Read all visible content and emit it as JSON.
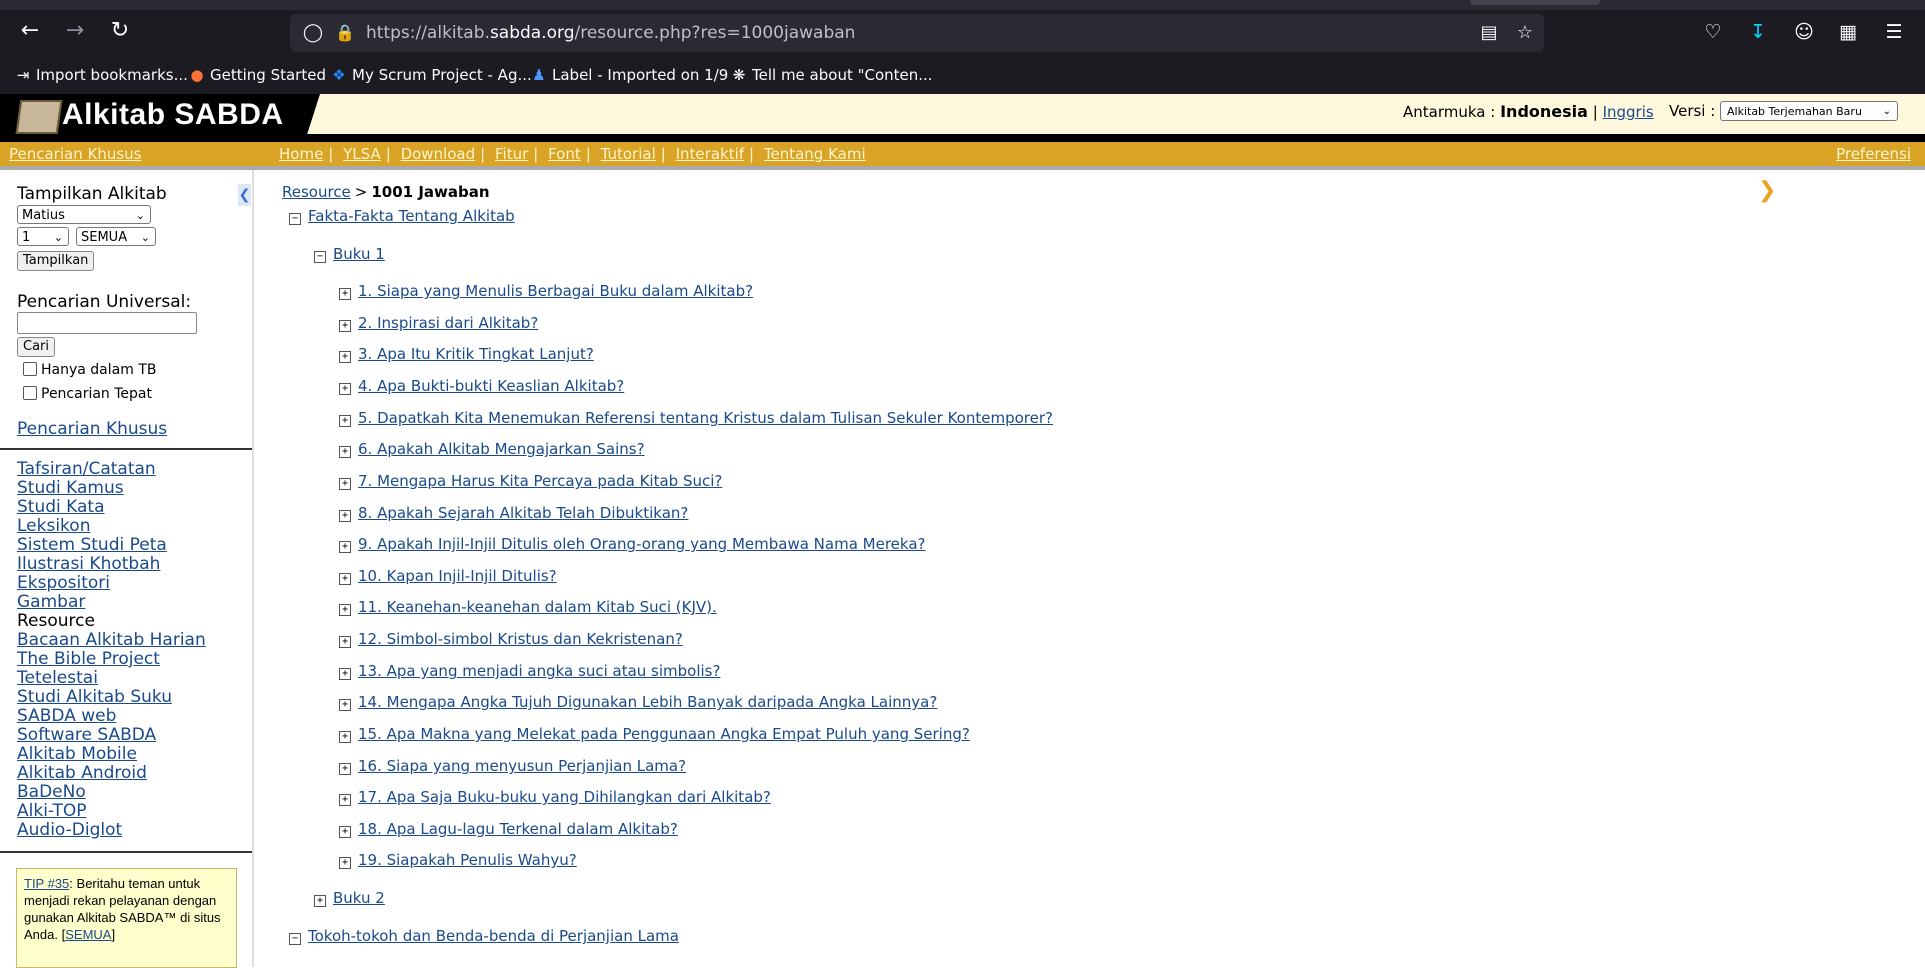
{
  "browser": {
    "url_prefix": "https://alkitab.",
    "url_host": "sabda.org",
    "url_suffix": "/resource.php?res=1000jawaban",
    "bookmarks": [
      {
        "label": "Import bookmarks...",
        "icon": "import-icon"
      },
      {
        "label": "Getting Started",
        "icon": "firefox-icon"
      },
      {
        "label": "My Scrum Project - Ag...",
        "icon": "jira-icon"
      },
      {
        "label": "Label - Imported on 1/9",
        "icon": "person-icon"
      },
      {
        "label": "Tell me about \"Conten...",
        "icon": "chatgpt-icon"
      }
    ]
  },
  "header": {
    "logo_text": "Alkitab SABDA",
    "interface_label": "Antarmuka :",
    "interface_current": "Indonesia",
    "interface_sep": "|",
    "interface_alt": "Inggris",
    "version_label": "Versi :",
    "version_value": "Alkitab Terjemahan Baru"
  },
  "navbar": {
    "left_link": "Pencarian Khusus",
    "links": [
      "Home",
      "YLSA",
      "Download",
      "Fitur",
      "Font",
      "Tutorial",
      "Interaktif",
      "Tentang Kami"
    ],
    "right_link": "Preferensi"
  },
  "sidebar": {
    "show_title": "Tampilkan Alkitab",
    "book_select": "Matius",
    "chapter_select": "1",
    "verse_select": "SEMUA",
    "show_button": "Tampilkan",
    "search_label": "Pencarian Universal:",
    "search_value": "",
    "search_button": "Cari",
    "check_tb": "Hanya dalam TB",
    "check_exact": "Pencarian Tepat",
    "special_search": "Pencarian Khusus",
    "links": [
      "Tafsiran/Catatan",
      "Studi Kamus",
      "Studi Kata",
      "Leksikon",
      "Sistem Studi Peta",
      "Ilustrasi Khotbah",
      "Ekspositori",
      "Gambar",
      "Resource",
      "Bacaan Alkitab Harian",
      "The Bible Project",
      "Tetelestai",
      "Studi Alkitab Suku",
      "SABDA web",
      "Software SABDA",
      "Alkitab Mobile",
      "Alkitab Android",
      "BaDeNo",
      "Alki-TOP",
      "Audio-Diglot"
    ],
    "current_link": "Resource",
    "tip_link": "TIP #35",
    "tip_text": ": Beritahu teman untuk menjadi rekan pelayanan dengan gunakan Alkitab SABDA™ di situs Anda.",
    "tip_all_open": "[",
    "tip_all": "SEMUA",
    "tip_all_close": "]"
  },
  "main": {
    "breadcrumb_root": "Resource",
    "breadcrumb_sep": ">",
    "breadcrumb_current": "1001 Jawaban",
    "section1": "Fakta-Fakta Tentang Alkitab",
    "book1": "Buku 1",
    "items": [
      "1. Siapa yang Menulis Berbagai Buku dalam Alkitab?",
      "2. Inspirasi dari Alkitab?",
      "3. Apa Itu Kritik Tingkat Lanjut?",
      "4. Apa Bukti-bukti Keaslian Alkitab?",
      "5. Dapatkah Kita Menemukan Referensi tentang Kristus dalam Tulisan Sekuler Kontemporer?",
      "6. Apakah Alkitab Mengajarkan Sains?",
      "7. Mengapa Harus Kita Percaya pada Kitab Suci?",
      "8. Apakah Sejarah Alkitab Telah Dibuktikan?",
      "9. Apakah Injil-Injil Ditulis oleh Orang-orang yang Membawa Nama Mereka?",
      "10. Kapan Injil-Injil Ditulis?",
      "11. Keanehan-keanehan dalam Kitab Suci (KJV).",
      "12. Simbol-simbol Kristus dan Kekristenan?",
      "13. Apa yang menjadi angka suci atau simbolis?",
      "14. Mengapa Angka Tujuh Digunakan Lebih Banyak daripada Angka Lainnya?",
      "15. Apa Makna yang Melekat pada Penggunaan Angka Empat Puluh yang Sering?",
      "16. Siapa yang menyusun Perjanjian Lama?",
      "17. Apa Saja Buku-buku yang Dihilangkan dari Alkitab?",
      "18. Apa Lagu-lagu Terkenal dalam Alkitab?",
      "19. Siapakah Penulis Wahyu?"
    ],
    "book2": "Buku 2",
    "section2": "Tokoh-tokoh dan Benda-benda di Perjanjian Lama"
  },
  "colors": {
    "gold_bar": "#d9a425",
    "header_bg": "#fff8dc",
    "link": "#1a4a8a",
    "tip_bg": "#ffffcc"
  }
}
